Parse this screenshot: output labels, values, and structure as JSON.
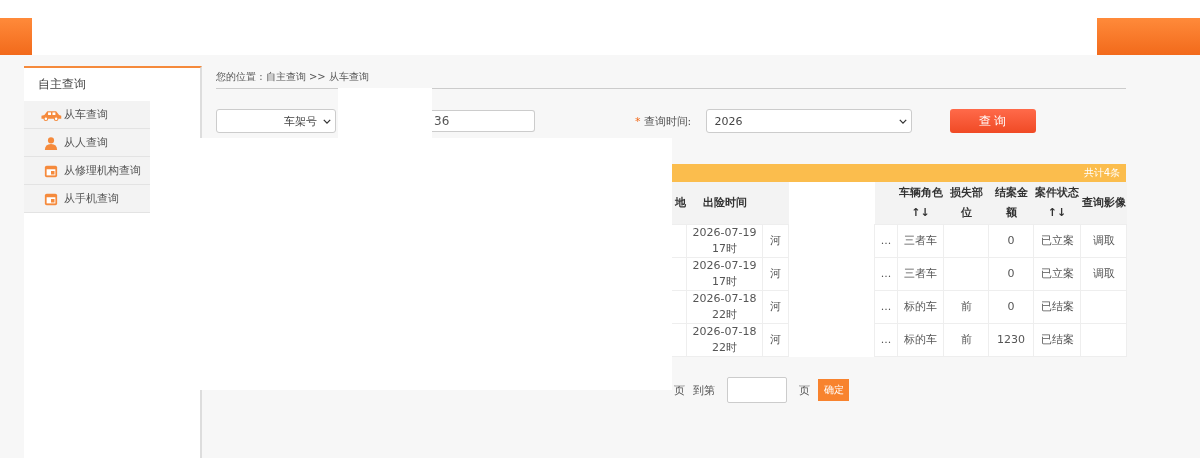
{
  "sidebar": {
    "title": "自主查询",
    "items": [
      {
        "label": "从车查询"
      },
      {
        "label": "从人查询"
      },
      {
        "label": "从修理机构查询"
      },
      {
        "label": "从手机查询"
      }
    ]
  },
  "breadcrumb": "您的位置 : 自主查询 >> 从车查询",
  "search": {
    "field_select": "车架号",
    "value": "36",
    "required_mark": "*",
    "time_label": "查询时间:",
    "time_select": "2026",
    "button": "查 询"
  },
  "table": {
    "total": "共计4条",
    "headers": [
      "地",
      "出险时间",
      "车辆角色↑↓",
      "损失部位",
      "结案金额",
      "案件状态↑↓",
      "查询影像"
    ],
    "rows": [
      {
        "time": "2026-07-19 17时",
        "column_3": "河",
        "column_5": "...",
        "role": "三者车",
        "amount": "0",
        "status": "已立案",
        "image": "调取"
      },
      {
        "time": "2026-07-19 17时",
        "column_3": "河",
        "column_5": "...",
        "role": "三者车",
        "amount": "0",
        "status": "已立案",
        "image": "调取"
      },
      {
        "time": "2026-07-18 22时",
        "column_3": "河",
        "column_5": "...",
        "role": "标的车",
        "part": "前",
        "amount": "0",
        "status": "已结案"
      },
      {
        "time": "2026-07-18 22时",
        "column_3": "河",
        "column_5": "...",
        "role": "标的车",
        "part": "前",
        "amount": "1230",
        "status": "已结案"
      }
    ]
  },
  "pagination": {
    "page_suffix": "页",
    "goto_label": "到第",
    "goto_suffix": "页",
    "confirm": "确定"
  }
}
